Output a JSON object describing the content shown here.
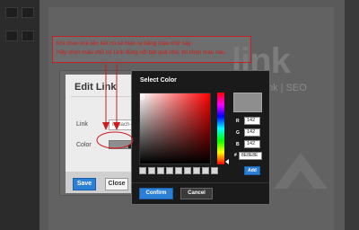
{
  "background": {
    "logo_text": "link",
    "tagline": "nk | SEO"
  },
  "edit_link_dialog": {
    "title": "Edit Link",
    "link_label": "Link",
    "link_value": "ih-sach-ca",
    "color_label": "Color",
    "color_value": "#8E8E8E",
    "save_label": "Save",
    "close_label": "Close"
  },
  "annotation": {
    "line1": "Khi chèn link liên kết nó sẽ hiện ra bảng màu chữ này.",
    "line2": "Hãy chọn màu chữ có Link đúng nổi bật quá nhé, tôi chọn màu nâu"
  },
  "select_color_dialog": {
    "title": "Select Color",
    "r_label": "R",
    "g_label": "G",
    "b_label": "B",
    "r_value": "142",
    "g_value": "142",
    "b_value": "142",
    "hash_label": "#",
    "hex_value": "8E8E8E",
    "add_label": "Add",
    "confirm_label": "Confirm",
    "cancel_label": "Cancel",
    "preview_color": "#8E8E8E"
  },
  "colors": {
    "accent": "#2C7FD6",
    "annotation_red": "#D01C1C"
  }
}
